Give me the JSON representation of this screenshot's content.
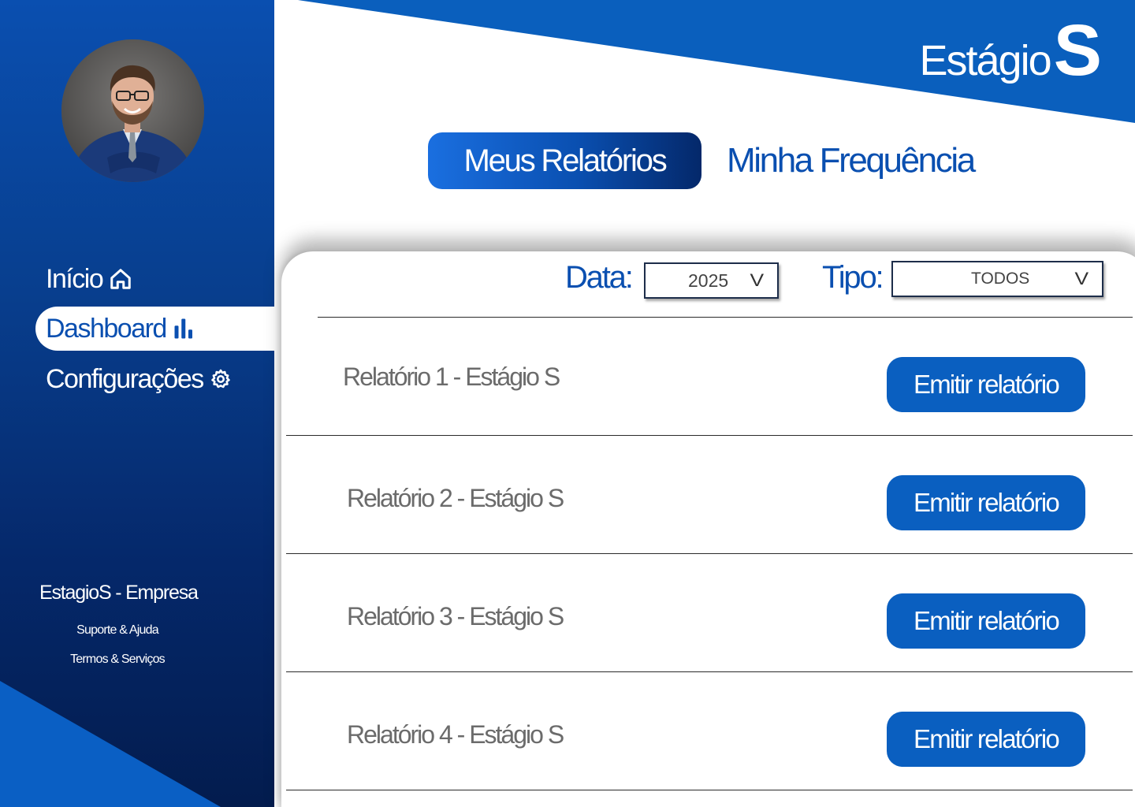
{
  "brand": {
    "text": "Estágio",
    "letter": "S"
  },
  "sidebar": {
    "nav": [
      {
        "label": "Início",
        "icon": "home-icon",
        "active": false
      },
      {
        "label": "Dashboard",
        "icon": "bar-chart-icon",
        "active": true
      },
      {
        "label": "Configurações",
        "icon": "gear-icon",
        "active": false
      }
    ],
    "company": "EstagioS - Empresa",
    "links": [
      "Suporte & Ajuda",
      "Termos & Serviços"
    ]
  },
  "tabs": {
    "active": "Meus Relatórios",
    "inactive": "Minha Frequência"
  },
  "filters": {
    "data_label": "Data:",
    "data_value": "2025",
    "tipo_label": "Tipo:",
    "tipo_value": "TODOS",
    "chevron": "V"
  },
  "reports": [
    {
      "title": "Relatório 1 - Estágio S",
      "button": "Emitir relatório"
    },
    {
      "title": "Relatório 2 - Estágio S",
      "button": "Emitir relatório"
    },
    {
      "title": "Relatório 3 - Estágio S",
      "button": "Emitir relatório"
    },
    {
      "title": "Relatório 4 - Estágio S",
      "button": "Emitir relatório"
    }
  ],
  "colors": {
    "primary": "#0a5fc0",
    "sidebar_dark": "#031c4e",
    "text_muted": "#6b6b6b"
  }
}
